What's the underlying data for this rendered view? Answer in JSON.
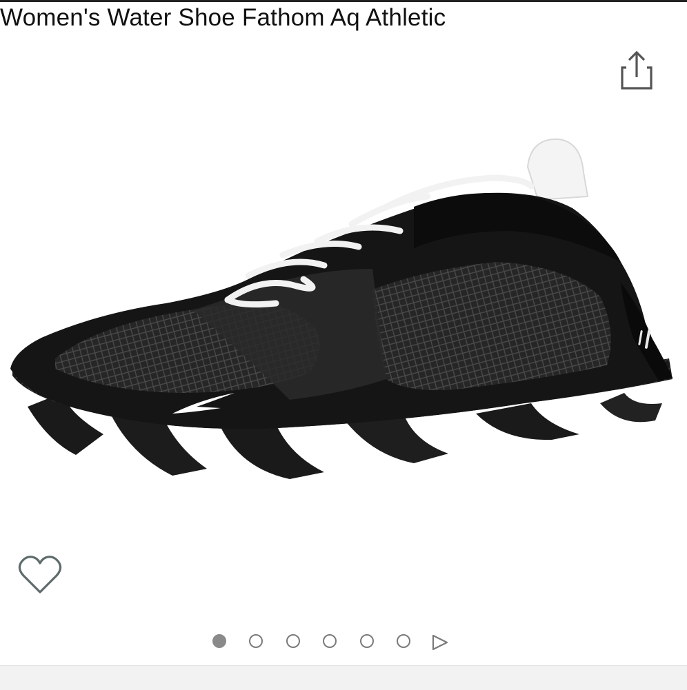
{
  "product": {
    "title": "Women's Water Shoe Fathom Aq Athletic"
  },
  "image": {
    "subject": "shoe-image",
    "colors": {
      "upper": "#141414",
      "mesh": "#2b2b2b",
      "sole_white": "#ffffff",
      "laces": "#ffffff"
    }
  },
  "actions": {
    "share_icon": "share-icon",
    "favorite_icon": "heart-icon"
  },
  "gallery": {
    "total_images": 6,
    "current_index": 1,
    "next_icon": "play-triangle-icon"
  },
  "colors": {
    "dot_active": "#8a8a8a",
    "dot_border": "#7a7a7a",
    "icon_gray": "#555555"
  }
}
